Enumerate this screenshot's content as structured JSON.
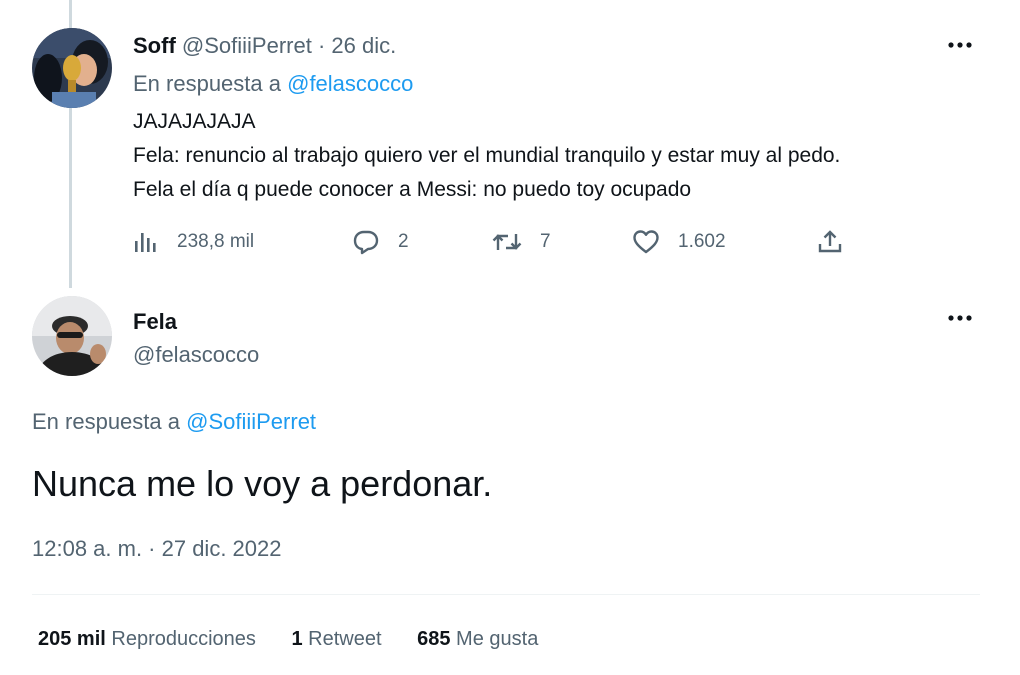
{
  "reply_tweet": {
    "name": "Soff",
    "handle": "@SofiiiPerret",
    "separator": "·",
    "date": "26 dic.",
    "reply_prefix": "En respuesta a",
    "reply_to": "@felascocco",
    "lines": [
      "JAJAJAJAJA",
      "Fela: renuncio al trabajo quiero ver el mundial tranquilo y estar muy al pedo.",
      "Fela el día q puede conocer a Messi: no puedo toy ocupado"
    ],
    "actions": {
      "views": "238,8 mil",
      "replies": "2",
      "retweets": "7",
      "likes": "1.602"
    },
    "icons": {
      "views": "bar-chart-icon",
      "reply": "speech-bubble-icon",
      "retweet": "retweet-arrows-icon",
      "like": "heart-icon",
      "share": "share-upload-icon",
      "more": "more-dots-icon"
    }
  },
  "main_tweet": {
    "name": "Fela",
    "handle": "@felascocco",
    "reply_prefix": "En respuesta a",
    "reply_to": "@SofiiiPerret",
    "text": "Nunca me lo voy a perdonar.",
    "timestamp": "12:08 a. m. · 27 dic. 2022",
    "stats": {
      "views_count": "205 mil",
      "views_label": "Reproducciones",
      "retweets_count": "1",
      "retweets_label": "Retweet",
      "likes_count": "685",
      "likes_label": "Me gusta"
    }
  },
  "colors": {
    "text": "#0f1419",
    "secondary": "#536471",
    "link": "#1d9bf0",
    "thread_line": "#cfd9de"
  }
}
